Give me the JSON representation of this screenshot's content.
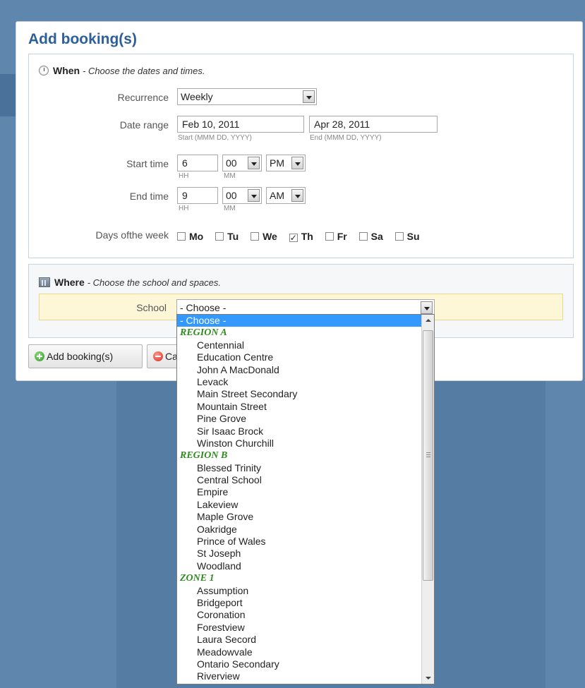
{
  "dialog": {
    "title": "Add booking(s)"
  },
  "when": {
    "heading": "When",
    "subheading": "- Choose the dates and times.",
    "recurrence": {
      "label": "Recurrence",
      "value": "Weekly"
    },
    "date_range": {
      "label": "Date range",
      "start_value": "Feb 10, 2011",
      "start_hint": "Start (MMM DD, YYYY)",
      "end_value": "Apr 28, 2011",
      "end_hint": "End (MMM DD, YYYY)"
    },
    "start_time": {
      "label": "Start time",
      "hour": "6",
      "minute": "00",
      "ampm": "PM",
      "hour_hint": "HH",
      "minute_hint": "MM"
    },
    "end_time": {
      "label": "End time",
      "hour": "9",
      "minute": "00",
      "ampm": "AM",
      "hour_hint": "HH",
      "minute_hint": "MM"
    },
    "days_label": "Days ofthe week",
    "days": [
      {
        "label": "Mo",
        "checked": false
      },
      {
        "label": "Tu",
        "checked": false
      },
      {
        "label": "We",
        "checked": false
      },
      {
        "label": "Th",
        "checked": true
      },
      {
        "label": "Fr",
        "checked": false
      },
      {
        "label": "Sa",
        "checked": false
      },
      {
        "label": "Su",
        "checked": false
      }
    ]
  },
  "where": {
    "heading": "Where",
    "subheading": "- Choose the school and spaces.",
    "school_label": "School",
    "school_value": "- Choose -"
  },
  "buttons": {
    "add_label": "Add booking(s)",
    "cancel_label": "Cancel"
  },
  "dropdown": {
    "selected": "- Choose -",
    "groups": [
      {
        "name": "REGION A",
        "items": [
          "Centennial",
          "Education Centre",
          "John A MacDonald",
          "Levack",
          "Main Street Secondary",
          "Mountain Street",
          "Pine Grove",
          "Sir Isaac Brock",
          "Winston Churchill"
        ]
      },
      {
        "name": "REGION B",
        "items": [
          "Blessed Trinity",
          "Central School",
          "Empire",
          "Lakeview",
          "Maple Grove",
          "Oakridge",
          "Prince of Wales",
          "St Joseph",
          "Woodland"
        ]
      },
      {
        "name": "ZONE 1",
        "items": [
          "Assumption",
          "Bridgeport",
          "Coronation",
          "Forestview",
          "Laura Secord",
          "Meadowvale",
          "Ontario Secondary",
          "Riverview"
        ]
      }
    ]
  }
}
